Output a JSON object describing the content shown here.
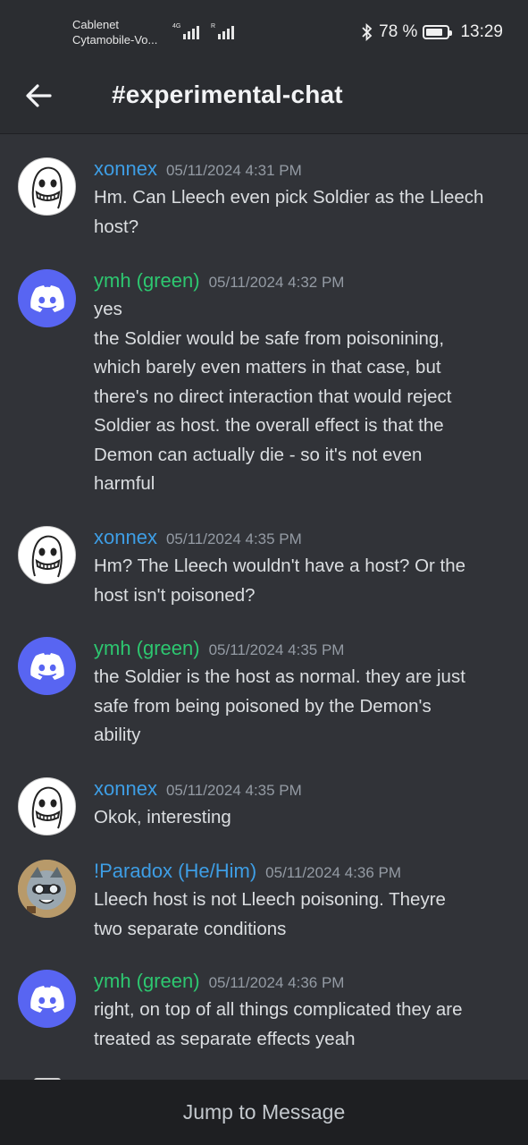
{
  "status": {
    "carrier_line1": "Cablenet",
    "carrier_line2": "Cytamobile-Vo...",
    "net_tag1": "4G",
    "net_tag2": "R",
    "battery": "78 %",
    "battery_level": 0.78,
    "time": "13:29"
  },
  "header": {
    "channel": "#experimental-chat"
  },
  "colors": {
    "background": "#313338",
    "header": "#2b2d31",
    "blurple": "#5865f2",
    "author_blue": "#3e9ee5",
    "author_green": "#2dc770"
  },
  "messages": [
    {
      "author": "xonnex",
      "avatar": "face-avatar",
      "timestamp": "05/11/2024 4:31 PM",
      "lines": [
        "Hm. Can Lleech even pick Soldier as the Lleech",
        "host?"
      ]
    },
    {
      "author": "ymh (green)",
      "avatar": "discord-icon",
      "timestamp": "05/11/2024 4:32 PM",
      "lines": [
        "yes",
        "the Soldier would be safe from poisonining,",
        "which barely even matters in that case, but",
        "there's no direct interaction that would reject",
        "Soldier as host. the overall effect is that the",
        "Demon can actually die - so it's not even",
        "harmful"
      ]
    },
    {
      "author": "xonnex",
      "avatar": "face-avatar",
      "timestamp": "05/11/2024 4:35 PM",
      "lines": [
        "Hm? The Lleech wouldn't have a host? Or the",
        "host isn't poisoned?"
      ]
    },
    {
      "author": "ymh (green)",
      "avatar": "discord-icon",
      "timestamp": "05/11/2024 4:35 PM",
      "lines": [
        "the Soldier is the host as normal. they are just",
        "safe from being poisoned by the Demon's",
        "ability"
      ]
    },
    {
      "author": "xonnex",
      "avatar": "face-avatar",
      "timestamp": "05/11/2024 4:35 PM",
      "lines": [
        "Okok, interesting"
      ]
    },
    {
      "author": "!Paradox (He/Him)",
      "avatar": "raccoon-avatar",
      "timestamp": "05/11/2024 4:36 PM",
      "lines": [
        "Lleech host is not Lleech poisoning. Theyre",
        "two separate conditions"
      ]
    },
    {
      "author": "ymh (green)",
      "avatar": "discord-icon",
      "timestamp": "05/11/2024 4:36 PM",
      "lines": [
        "right, on top of all things complicated they are",
        "treated as separate effects yeah"
      ]
    }
  ],
  "footer": {
    "jump_label": "Jump to Message"
  }
}
